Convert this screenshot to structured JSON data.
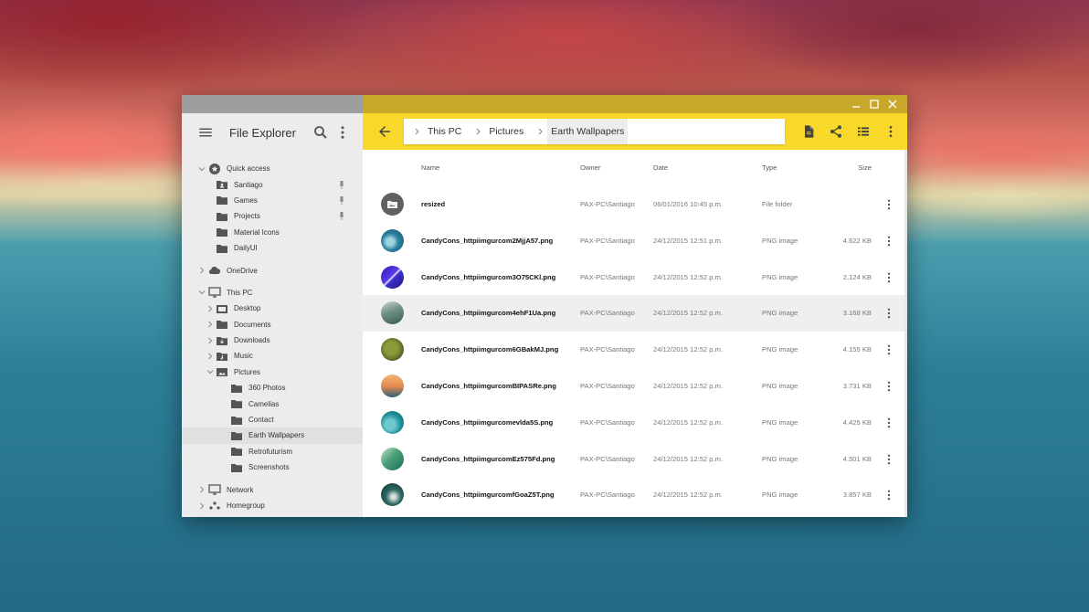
{
  "app": {
    "title": "File Explorer"
  },
  "colors": {
    "accent": "#f8d82a",
    "titlebar": "#c8a82a",
    "sidebar_bg": "#ececec"
  },
  "sidebar": {
    "menu_icon": "menu-icon",
    "search_icon": "search-icon",
    "more_icon": "more-vert-icon",
    "tree": [
      {
        "label": "Quick access",
        "level": 0,
        "expanded": true,
        "icon": "star-icon",
        "chevron": "down"
      },
      {
        "label": "Santiago",
        "level": 1,
        "icon": "folder-user-icon",
        "pinned": true
      },
      {
        "label": "Games",
        "level": 1,
        "icon": "folder-icon",
        "pinned": true
      },
      {
        "label": "Projects",
        "level": 1,
        "icon": "folder-icon",
        "pinned": true
      },
      {
        "label": "Material Icons",
        "level": 1,
        "icon": "folder-icon"
      },
      {
        "label": "DailyUI",
        "level": 1,
        "icon": "folder-icon"
      },
      {
        "gap": true
      },
      {
        "label": "OneDrive",
        "level": 0,
        "icon": "cloud-icon",
        "chevron": "right"
      },
      {
        "gap": true
      },
      {
        "label": "This PC",
        "level": 0,
        "icon": "monitor-icon",
        "chevron": "down"
      },
      {
        "label": "Desktop",
        "level": 1,
        "icon": "folder-desktop-icon",
        "chevron": "right"
      },
      {
        "label": "Documents",
        "level": 1,
        "icon": "folder-icon",
        "chevron": "right"
      },
      {
        "label": "Downloads",
        "level": 1,
        "icon": "folder-download-icon",
        "chevron": "right"
      },
      {
        "label": "Music",
        "level": 1,
        "icon": "folder-music-icon",
        "chevron": "right"
      },
      {
        "label": "Pictures",
        "level": 1,
        "icon": "folder-image-icon",
        "chevron": "down"
      },
      {
        "label": "360 Photos",
        "level": 2,
        "icon": "folder-icon"
      },
      {
        "label": "Camelias",
        "level": 2,
        "icon": "folder-icon"
      },
      {
        "label": "Contact",
        "level": 2,
        "icon": "folder-icon"
      },
      {
        "label": "Earth Wallpapers",
        "level": 2,
        "icon": "folder-icon",
        "selected": true
      },
      {
        "label": "Retrofuturism",
        "level": 2,
        "icon": "folder-icon"
      },
      {
        "label": "Screenshots",
        "level": 2,
        "icon": "folder-icon"
      },
      {
        "gap": true
      },
      {
        "label": "Network",
        "level": 0,
        "icon": "monitor-icon",
        "chevron": "right"
      },
      {
        "label": "Homegroup",
        "level": 0,
        "icon": "homegroup-icon",
        "chevron": "right"
      }
    ]
  },
  "toolbar": {
    "back_icon": "arrow-back-icon",
    "breadcrumb": [
      "This PC",
      "Pictures",
      "Earth Wallpapers"
    ],
    "actions": [
      "new-file-icon",
      "share-icon",
      "list-view-icon",
      "more-vert-icon"
    ]
  },
  "table": {
    "headers": {
      "name": "Name",
      "owner": "Owner",
      "date": "Date",
      "type": "Type",
      "size": "Size"
    },
    "rows": [
      {
        "name": "resized",
        "owner": "PAX-PC\\Santiago",
        "date": "06/01/2016 10:45 p.m.",
        "type": "File folder",
        "size": "",
        "thumb": "folder",
        "highlight": false
      },
      {
        "name": "CandyCons_httpiimgurcom2MjjA57.png",
        "owner": "PAX-PC\\Santiago",
        "date": "24/12/2015 12:51 p.m.",
        "type": "PNG image",
        "size": "4.622 KB",
        "thumb": "t1"
      },
      {
        "name": "CandyCons_httpiimgurcom3O75CKl.png",
        "owner": "PAX-PC\\Santiago",
        "date": "24/12/2015 12:52 p.m.",
        "type": "PNG image",
        "size": "2.124 KB",
        "thumb": "t2"
      },
      {
        "name": "CandyCons_httpiimgurcom4ehF1Ua.png",
        "owner": "PAX-PC\\Santiago",
        "date": "24/12/2015 12:52 p.m.",
        "type": "PNG image",
        "size": "3.168 KB",
        "thumb": "t3",
        "highlight": true
      },
      {
        "name": "CandyCons_httpiimgurcom6GBakMJ.png",
        "owner": "PAX-PC\\Santiago",
        "date": "24/12/2015 12:52 p.m.",
        "type": "PNG image",
        "size": "4.155 KB",
        "thumb": "t4"
      },
      {
        "name": "CandyCons_httpiimgurcomBIPASRe.png",
        "owner": "PAX-PC\\Santiago",
        "date": "24/12/2015 12:52 p.m.",
        "type": "PNG image",
        "size": "3.731 KB",
        "thumb": "t5"
      },
      {
        "name": "CandyCons_httpiimgurcomevlda5S.png",
        "owner": "PAX-PC\\Santiago",
        "date": "24/12/2015 12:52 p.m.",
        "type": "PNG image",
        "size": "4.425 KB",
        "thumb": "t6"
      },
      {
        "name": "CandyCons_httpiimgurcomEz575Fd.png",
        "owner": "PAX-PC\\Santiago",
        "date": "24/12/2015 12:52 p.m.",
        "type": "PNG image",
        "size": "4.501 KB",
        "thumb": "t7"
      },
      {
        "name": "CandyCons_httpiimgurcomfGoaZ5T.png",
        "owner": "PAX-PC\\Santiago",
        "date": "24/12/2015 12:52 p.m.",
        "type": "PNG image",
        "size": "3.857 KB",
        "thumb": "t8"
      }
    ]
  }
}
